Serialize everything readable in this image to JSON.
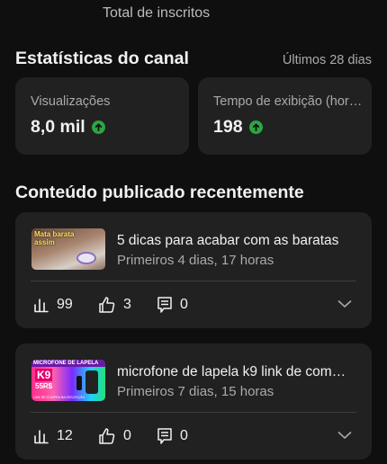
{
  "header": {
    "subscribers_label": "Total de inscritos"
  },
  "stats_section": {
    "title": "Estatísticas do canal",
    "range": "Últimos 28 dias",
    "cards": [
      {
        "label": "Visualizações",
        "value": "8,0 mil",
        "trend": "up"
      },
      {
        "label": "Tempo de exibição (hor…",
        "value": "198",
        "trend": "up"
      }
    ]
  },
  "recent_section": {
    "title": "Conteúdo publicado recentemente",
    "videos": [
      {
        "title": "5 dicas para acabar com as baratas",
        "subtitle": "Primeiros 4 dias, 17 horas",
        "thumbnail_text": [
          "Mata barata",
          "assim"
        ],
        "views": "99",
        "likes": "3",
        "comments": "0"
      },
      {
        "title": "microfone de lapela k9 link de com…",
        "subtitle": "Primeiros 7 dias, 15 horas",
        "thumbnail_text": [
          "MICROFONE DE LAPELA",
          "K9",
          "55R$",
          "LINK DE COMPRA NA DESCRIÇÃO"
        ],
        "views": "12",
        "likes": "0",
        "comments": "0"
      }
    ]
  },
  "colors": {
    "background": "#0f0f0f",
    "card": "#212121",
    "trend_up": "#2ba640"
  }
}
